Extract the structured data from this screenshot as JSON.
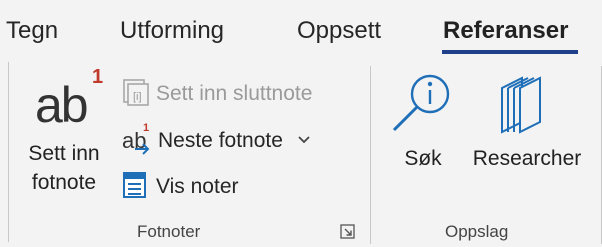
{
  "tabs": [
    {
      "label": "Tegn",
      "active": false
    },
    {
      "label": "Utforming",
      "active": false
    },
    {
      "label": "Oppsett",
      "active": false
    },
    {
      "label": "Referanser",
      "active": true
    }
  ],
  "groups": {
    "fotnoter": {
      "label": "Fotnoter",
      "insert_footnote": {
        "label_line1": "Sett inn",
        "label_line2": "fotnote",
        "icon_text": "ab",
        "icon_sup": "1"
      },
      "insert_endnote": {
        "label": "Sett inn sluttnote",
        "enabled": false
      },
      "next_footnote": {
        "label": "Neste fotnote",
        "icon_text": "ab",
        "icon_sup": "1"
      },
      "show_notes": {
        "label": "Vis noter"
      }
    },
    "oppslag": {
      "label": "Oppslag",
      "search": {
        "label": "Søk"
      },
      "researcher": {
        "label": "Researcher"
      }
    }
  },
  "colors": {
    "accent_blue": "#1f6fb8",
    "underline": "#1f3f8a",
    "footnote_red": "#c0392b",
    "disabled_gray": "#9a9a9a"
  }
}
